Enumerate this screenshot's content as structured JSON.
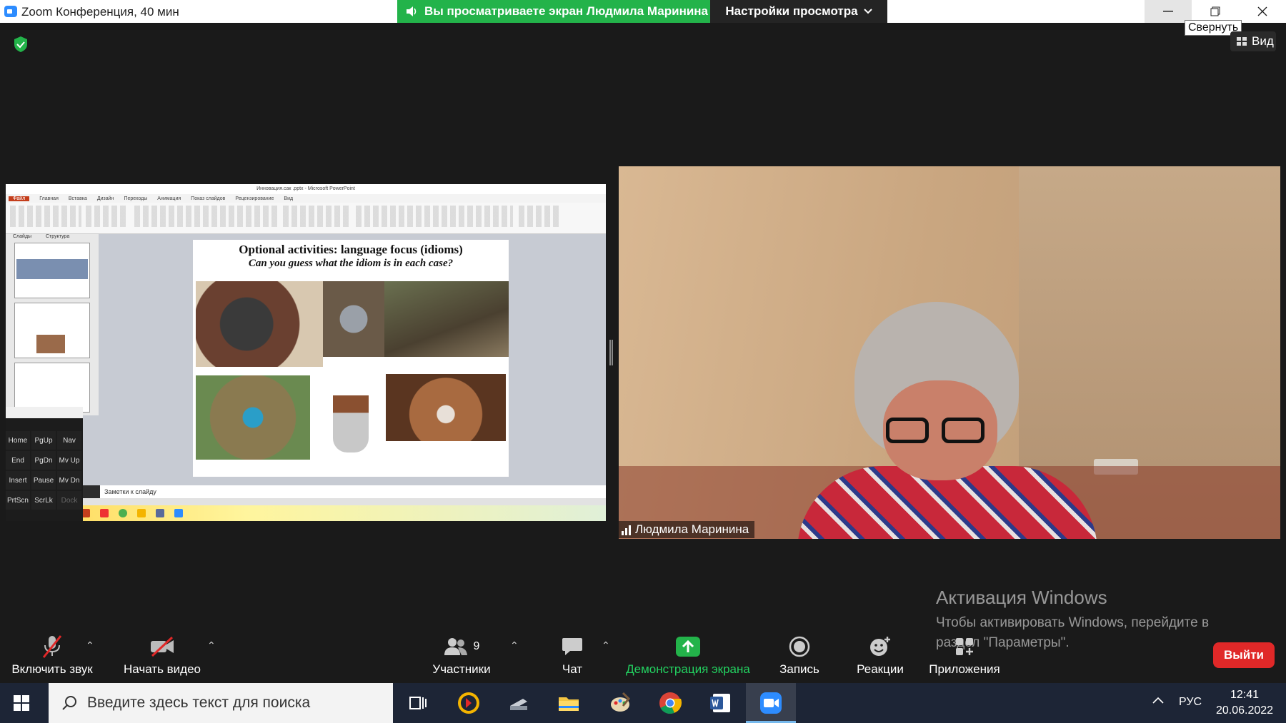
{
  "window": {
    "title": "Zoom Конференция, 40 мин",
    "share_banner": "Вы просматриваете экран Людмила Маринина",
    "view_settings": "Настройки просмотра",
    "tooltip_minimize": "Свернуть",
    "view_button": "Вид"
  },
  "shared_screen": {
    "ppt_title": "Инновация.сак .pptx - Microsoft PowerPoint",
    "ribbon_tabs": [
      "Файл",
      "Главная",
      "Вставка",
      "Дизайн",
      "Переходы",
      "Анимация",
      "Показ слайдов",
      "Рецензирование",
      "Вид"
    ],
    "thumb_tabs": [
      "Слайды",
      "Структура"
    ],
    "slide_title": "Optional activities: language focus (idioms)",
    "slide_subtitle": "Can you guess what the idiom is in each case?",
    "notes_placeholder": "Заметки к слайду",
    "keyboard_keys": [
      "Home",
      "PgUp",
      "Nav",
      "End",
      "PgDn",
      "Mv Up",
      "Insert",
      "Pause",
      "Mv Dn",
      "PrtScn",
      "ScrLk",
      "Dock"
    ]
  },
  "participant": {
    "name": "Людмила Маринина"
  },
  "watermark": {
    "title": "Активация Windows",
    "text": "Чтобы активировать Windows, перейдите в раздел \"Параметры\"."
  },
  "toolbar": {
    "unmute": "Включить звук",
    "start_video": "Начать видео",
    "participants": "Участники",
    "participants_count": "9",
    "chat": "Чат",
    "share_screen": "Демонстрация экрана",
    "record": "Запись",
    "reactions": "Реакции",
    "apps": "Приложения",
    "leave": "Выйти"
  },
  "taskbar": {
    "search_placeholder": "Введите здесь текст для поиска",
    "lang": "РУС",
    "time": "12:41",
    "date": "20.06.2022"
  },
  "colors": {
    "share_green": "#23b34a",
    "leave_red": "#e02828",
    "zoom_blue": "#2d8cff"
  }
}
